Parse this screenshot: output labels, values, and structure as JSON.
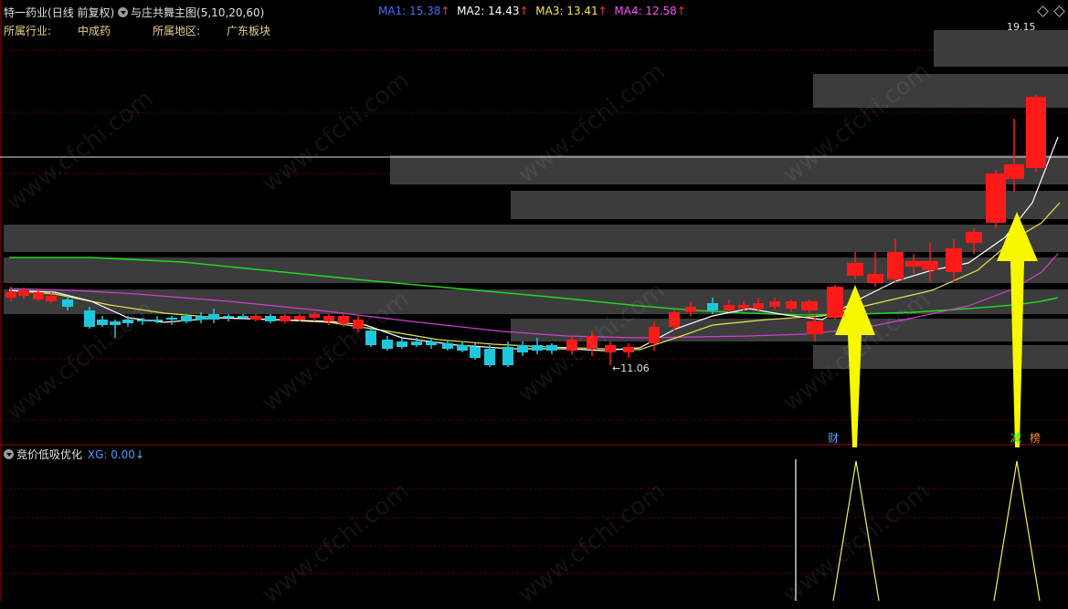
{
  "header": {
    "stock_name": "特一药业",
    "period": "(日线 前复权)",
    "indicator_title": "与庄共舞主图",
    "indicator_params": "(5,10,20,60)",
    "ma": [
      {
        "label": "MA1: 15.38",
        "color": "#4a6cff"
      },
      {
        "label": "MA2: 14.43",
        "color": "#ffffff"
      },
      {
        "label": "MA3: 13.41",
        "color": "#ffe34d"
      },
      {
        "label": "MA4: 12.58",
        "color": "#ff4dff"
      }
    ],
    "arrow_glyph": "↑"
  },
  "info": {
    "industry_label": "所属行业:",
    "industry_value": "中成药",
    "region_label": "所属地区:",
    "region_value": "广东板块"
  },
  "price_labels": {
    "high": "19.15",
    "low": "11.06",
    "low_arrow": "←"
  },
  "markers": {
    "cai": "财",
    "jian": "减",
    "ban": "榜"
  },
  "sub_panel": {
    "title": "竞价低吸优化",
    "xg_label": "XG: 0.00",
    "xg_arrow": "↓"
  },
  "colors": {
    "up": "#ff1a1a",
    "down": "#1ec8dc",
    "ma_green": "#22d422",
    "ma_white": "#ffffff",
    "ma_yellow": "#e6e64a",
    "ma_magenta": "#d040d0",
    "zone": "#3a3a3a",
    "signal_arrow": "#f7f700",
    "grid": "#7a0000"
  },
  "watermark": "www.cfchi.com"
}
